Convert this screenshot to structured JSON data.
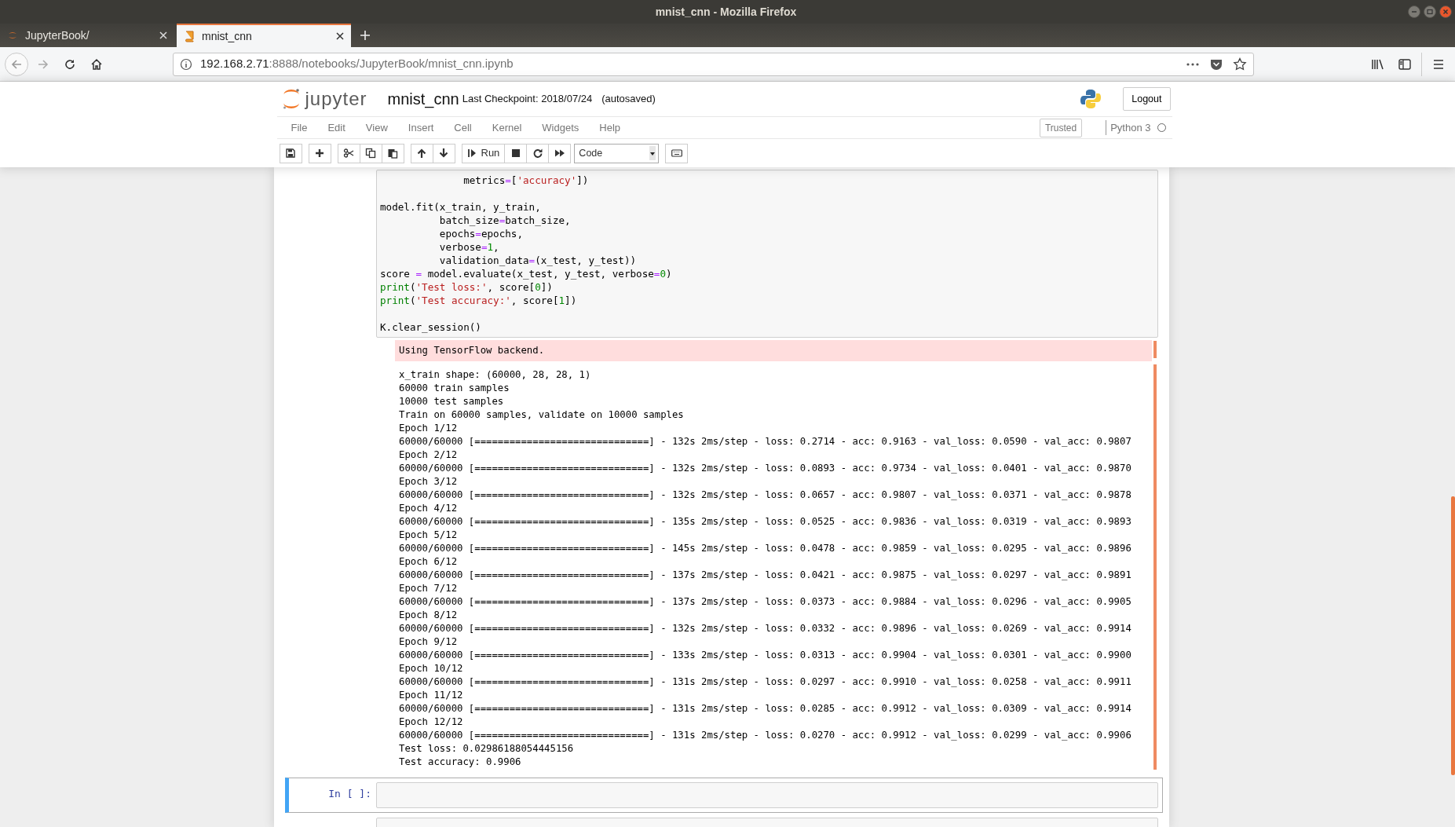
{
  "window": {
    "title": "mnist_cnn - Mozilla Firefox"
  },
  "tabs": [
    {
      "label": "JupyterBook/",
      "selected": false
    },
    {
      "label": "mnist_cnn",
      "selected": true
    }
  ],
  "address_bar": {
    "host": "192.168.2.71",
    "rest": ":8888/notebooks/JupyterBook/mnist_cnn.ipynb"
  },
  "header": {
    "logo_text": "jupyter",
    "notebook_name": "mnist_cnn",
    "checkpoint": "Last Checkpoint: 2018/07/24",
    "autosave": "(autosaved)",
    "logout": "Logout"
  },
  "menu": [
    "File",
    "Edit",
    "View",
    "Insert",
    "Cell",
    "Kernel",
    "Widgets",
    "Help"
  ],
  "trusted": "Trusted",
  "kernel": {
    "name": "Python 3",
    "busy": false
  },
  "toolbar": {
    "run": "Run",
    "cell_type": "Code"
  },
  "cells": [
    {
      "kind": "code",
      "selected": false,
      "lines": [
        {
          "kind": "code",
          "tokens": [
            {
              "text": "              metrics",
              "kind": "plain"
            },
            {
              "text": "=",
              "kind": "operator"
            },
            {
              "text": "[",
              "kind": "plain"
            },
            {
              "text": "'accuracy'",
              "kind": "string"
            },
            {
              "text": "])",
              "kind": "plain"
            }
          ]
        },
        {
          "kind": "blank"
        },
        {
          "kind": "code",
          "tokens": [
            {
              "text": "model.fit(x_train, y_train,",
              "kind": "plain"
            }
          ]
        },
        {
          "kind": "code",
          "tokens": [
            {
              "text": "          batch_size",
              "kind": "plain"
            },
            {
              "text": "=",
              "kind": "operator"
            },
            {
              "text": "batch_size,",
              "kind": "plain"
            }
          ]
        },
        {
          "kind": "code",
          "tokens": [
            {
              "text": "          epochs",
              "kind": "plain"
            },
            {
              "text": "=",
              "kind": "operator"
            },
            {
              "text": "epochs,",
              "kind": "plain"
            }
          ]
        },
        {
          "kind": "code",
          "tokens": [
            {
              "text": "          verbose",
              "kind": "plain"
            },
            {
              "text": "=",
              "kind": "operator"
            },
            {
              "text": "1",
              "kind": "number"
            },
            {
              "text": ",",
              "kind": "plain"
            }
          ]
        },
        {
          "kind": "code",
          "tokens": [
            {
              "text": "          validation_data",
              "kind": "plain"
            },
            {
              "text": "=",
              "kind": "operator"
            },
            {
              "text": "(x_test, y_test))",
              "kind": "plain"
            }
          ]
        },
        {
          "kind": "code",
          "tokens": [
            {
              "text": "score ",
              "kind": "plain"
            },
            {
              "text": "=",
              "kind": "operator"
            },
            {
              "text": " model.evaluate(x_test, y_test, verbose",
              "kind": "plain"
            },
            {
              "text": "=",
              "kind": "operator"
            },
            {
              "text": "0",
              "kind": "number"
            },
            {
              "text": ")",
              "kind": "plain"
            }
          ]
        },
        {
          "kind": "code",
          "tokens": [
            {
              "text": "print",
              "kind": "builtin"
            },
            {
              "text": "(",
              "kind": "plain"
            },
            {
              "text": "'Test loss:'",
              "kind": "string"
            },
            {
              "text": ", score[",
              "kind": "plain"
            },
            {
              "text": "0",
              "kind": "number"
            },
            {
              "text": "])",
              "kind": "plain"
            }
          ]
        },
        {
          "kind": "code",
          "tokens": [
            {
              "text": "print",
              "kind": "builtin"
            },
            {
              "text": "(",
              "kind": "plain"
            },
            {
              "text": "'Test accuracy:'",
              "kind": "string"
            },
            {
              "text": ", score[",
              "kind": "plain"
            },
            {
              "text": "1",
              "kind": "number"
            },
            {
              "text": "])",
              "kind": "plain"
            }
          ]
        },
        {
          "kind": "blank"
        },
        {
          "kind": "code",
          "tokens": [
            {
              "text": "K.clear_session()",
              "kind": "plain"
            }
          ]
        }
      ],
      "stderr": [
        "Using TensorFlow backend."
      ],
      "stdout": [
        "x_train shape: (60000, 28, 28, 1)",
        "60000 train samples",
        "10000 test samples",
        "Train on 60000 samples, validate on 10000 samples",
        "Epoch 1/12",
        "60000/60000 [==============================] - 132s 2ms/step - loss: 0.2714 - acc: 0.9163 - val_loss: 0.0590 - val_acc: 0.9807",
        "Epoch 2/12",
        "60000/60000 [==============================] - 132s 2ms/step - loss: 0.0893 - acc: 0.9734 - val_loss: 0.0401 - val_acc: 0.9870",
        "Epoch 3/12",
        "60000/60000 [==============================] - 132s 2ms/step - loss: 0.0657 - acc: 0.9807 - val_loss: 0.0371 - val_acc: 0.9878",
        "Epoch 4/12",
        "60000/60000 [==============================] - 135s 2ms/step - loss: 0.0525 - acc: 0.9836 - val_loss: 0.0319 - val_acc: 0.9893",
        "Epoch 5/12",
        "60000/60000 [==============================] - 145s 2ms/step - loss: 0.0478 - acc: 0.9859 - val_loss: 0.0295 - val_acc: 0.9896",
        "Epoch 6/12",
        "60000/60000 [==============================] - 137s 2ms/step - loss: 0.0421 - acc: 0.9875 - val_loss: 0.0297 - val_acc: 0.9891",
        "Epoch 7/12",
        "60000/60000 [==============================] - 137s 2ms/step - loss: 0.0373 - acc: 0.9884 - val_loss: 0.0296 - val_acc: 0.9905",
        "Epoch 8/12",
        "60000/60000 [==============================] - 132s 2ms/step - loss: 0.0332 - acc: 0.9896 - val_loss: 0.0269 - val_acc: 0.9914",
        "Epoch 9/12",
        "60000/60000 [==============================] - 133s 2ms/step - loss: 0.0313 - acc: 0.9904 - val_loss: 0.0301 - val_acc: 0.9900",
        "Epoch 10/12",
        "60000/60000 [==============================] - 131s 2ms/step - loss: 0.0297 - acc: 0.9910 - val_loss: 0.0258 - val_acc: 0.9911",
        "Epoch 11/12",
        "60000/60000 [==============================] - 131s 2ms/step - loss: 0.0285 - acc: 0.9912 - val_loss: 0.0309 - val_acc: 0.9914",
        "Epoch 12/12",
        "60000/60000 [==============================] - 131s 2ms/step - loss: 0.0270 - acc: 0.9912 - val_loss: 0.0299 - val_acc: 0.9906",
        "Test loss: 0.02986188054445156",
        "Test accuracy: 0.9906"
      ]
    },
    {
      "kind": "empty",
      "selected": true,
      "prompt": "In [ ]:"
    },
    {
      "kind": "empty",
      "selected": false
    }
  ]
}
